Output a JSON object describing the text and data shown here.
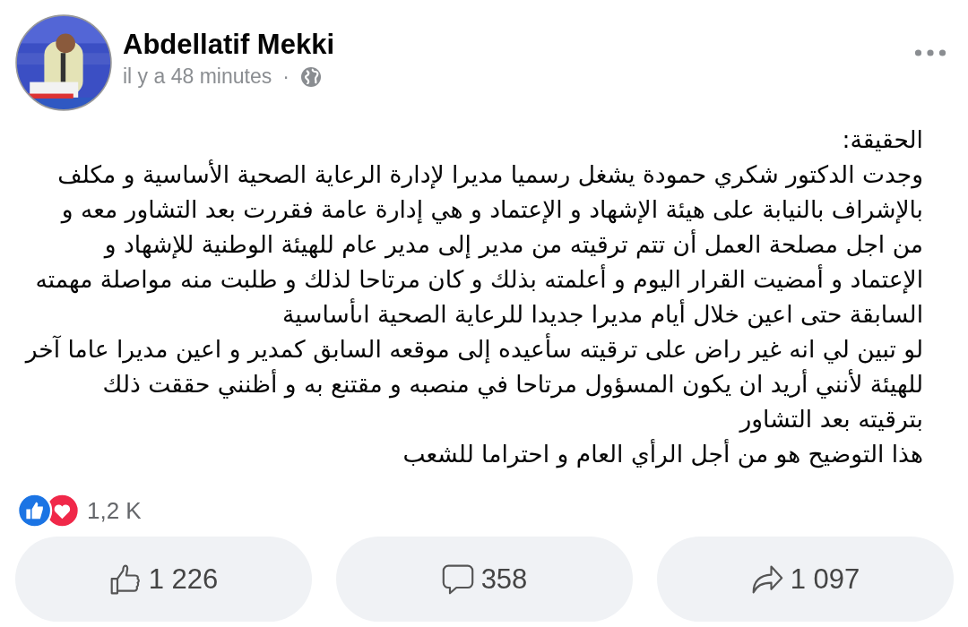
{
  "post": {
    "author": "Abdellatif Mekki",
    "time": "il y a 48 minutes",
    "separator": "·",
    "lines": [
      "الحقيقة:",
      "وجدت الدكتور شكري حمودة يشغل رسميا مديرا لإدارة الرعاية الصحية الأساسية و مكلف",
      "بالإشراف بالنيابة على هيئة الإشهاد و الإعتماد و هي إدارة عامة  فقررت بعد التشاور معه و",
      "من اجل مصلحة العمل أن تتم ترقيته من مدير إلى مدير عام للهيئة الوطنية للإشهاد و",
      "الإعتماد و أمضيت القرار اليوم  و أعلمته بذلك و كان مرتاحا لذلك و طلبت منه مواصلة مهمته",
      "السابقة حتى اعين خلال أيام مديرا جديدا للرعاية الصحية اىأساسية",
      "لو تبين لي انه غير راض على ترقيته سأعيده إلى موقعه السابق كمدير و اعين مديرا عاما آخر",
      "للهيئة لأنني أريد ان يكون المسؤول مرتاحا في منصبه و مقتنع به و أظنني حققت ذلك",
      "بترقيته بعد التشاور",
      "هذا التوضيح هو من أجل الرأي العام و احتراما للشعب"
    ],
    "reaction_count": "1,2 K",
    "like_button": {
      "count": "1 226"
    },
    "comment_button": {
      "count": "358"
    },
    "share_button": {
      "count": "1 097"
    }
  }
}
